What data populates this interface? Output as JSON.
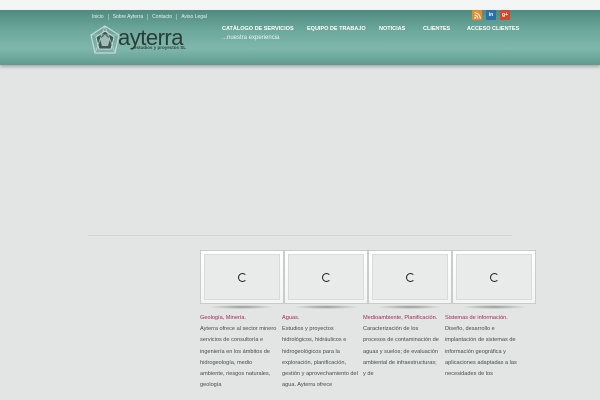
{
  "utility_links": [
    "Inicio",
    "Sobre Ayterra",
    "Contacto",
    "Aviso Legal"
  ],
  "social": {
    "rss": "rss-icon",
    "linkedin": "in",
    "googleplus": "g+"
  },
  "logo": {
    "name": "ayterra",
    "sub": "estudios y proyectos SL"
  },
  "nav": [
    "CATÁLOGO DE SERVICIOS",
    "EQUIPO DE TRABAJO",
    "NOTICIAS",
    "CLIENTES",
    "ACCESO CLIENTES"
  ],
  "tagline": "...nuestra experiencia",
  "services": [
    {
      "title": "Geología, Minería.",
      "body": "Ayterra ofrece al sector minero servicios de consultoría e ingeniería en los ámbitos de hidrogeología, medio ambiente, riesgos naturales, geología"
    },
    {
      "title": "Aguas.",
      "body": "Estudios y proyectos hidrológicos, hidráulicos e hidrogeológicos para la exploración, planificación, gestión y aprovechamiento del agua. Ayterra ofrece"
    },
    {
      "title": "Medioambiente, Planificación.",
      "body": "Caracterización de los procesos de contaminación de aguas y suelos; de evaluación ambiental de infraestructuras; y de"
    },
    {
      "title": "Sistemas de información.",
      "body": "Diseño, desarrollo e implantación de sistemas de información geográfica y aplicaciones adaptadas a las necesidades de los"
    }
  ],
  "colors": {
    "header": "#6aa79a",
    "accent": "#a32757",
    "background": "#e2e5e4"
  }
}
